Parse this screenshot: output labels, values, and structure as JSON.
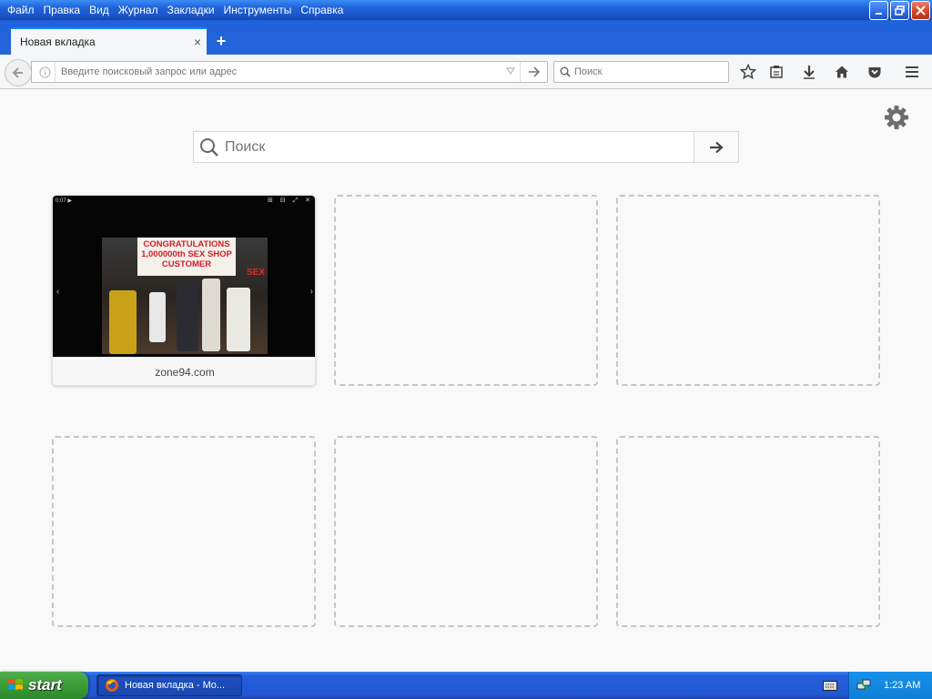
{
  "menu": [
    "Файл",
    "Правка",
    "Вид",
    "Журнал",
    "Закладки",
    "Инструменты",
    "Справка"
  ],
  "tab": {
    "title": "Новая вкладка",
    "close": "×"
  },
  "newtab_symbol": "+",
  "navbar": {
    "url_placeholder": "Введите поисковый запрос или адрес",
    "search_placeholder": "Поиск"
  },
  "newtab_page": {
    "search_placeholder": "Поиск",
    "tiles": [
      {
        "label": "zone94.com",
        "filled": true
      },
      {
        "filled": false
      },
      {
        "filled": false
      },
      {
        "filled": false
      },
      {
        "filled": false
      },
      {
        "filled": false
      }
    ],
    "thumbnail": {
      "banner_text": "CONGRATULATIONS 1,000000th SEX SHOP CUSTOMER",
      "sign_text": "SEX",
      "counter": "0:07 ▶",
      "controls": "⊞ ⊟ ⤢ ✕"
    }
  },
  "taskbar": {
    "start_label": "start",
    "task_label": "Новая вкладка - Mo...",
    "clock": "1:23 AM"
  },
  "colors": {
    "xp_blue": "#245ddb",
    "start_green": "#3c9c38",
    "tab_accent": "#0a84ff"
  }
}
